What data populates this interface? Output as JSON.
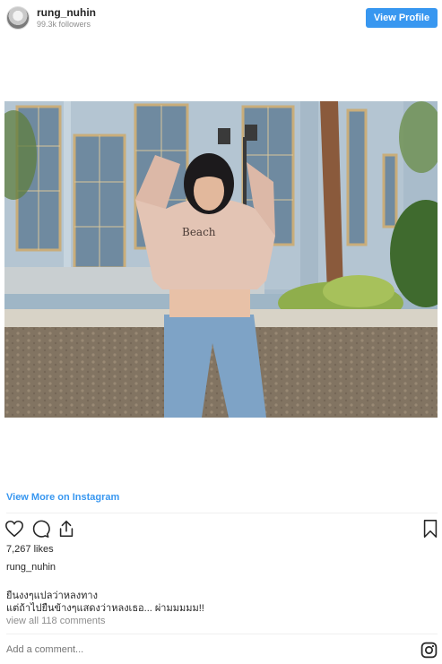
{
  "header": {
    "username": "rung_nuhin",
    "followers": "99.3k followers",
    "view_profile_label": "View Profile"
  },
  "post": {
    "image_alt": "rung_nuhin photo",
    "view_more_label": "View More on Instagram",
    "likes": "7,267 likes",
    "caption_user": "rung_nuhin",
    "caption_lines": [
      "ยืนงงๆแปลว่าหลงทาง",
      "แต่ถ้าไปยืนข้างๆแสดงว่าหลงเธอ... ผ่ามมมมม!!"
    ],
    "view_all_comments": "view all 118 comments",
    "comment_placeholder": "Add a comment..."
  },
  "colors": {
    "accent": "#3897f0",
    "text": "#262626",
    "muted": "#8e8e8e"
  },
  "icons": [
    "heart-icon",
    "comment-icon",
    "share-icon",
    "bookmark-icon",
    "instagram-icon"
  ]
}
